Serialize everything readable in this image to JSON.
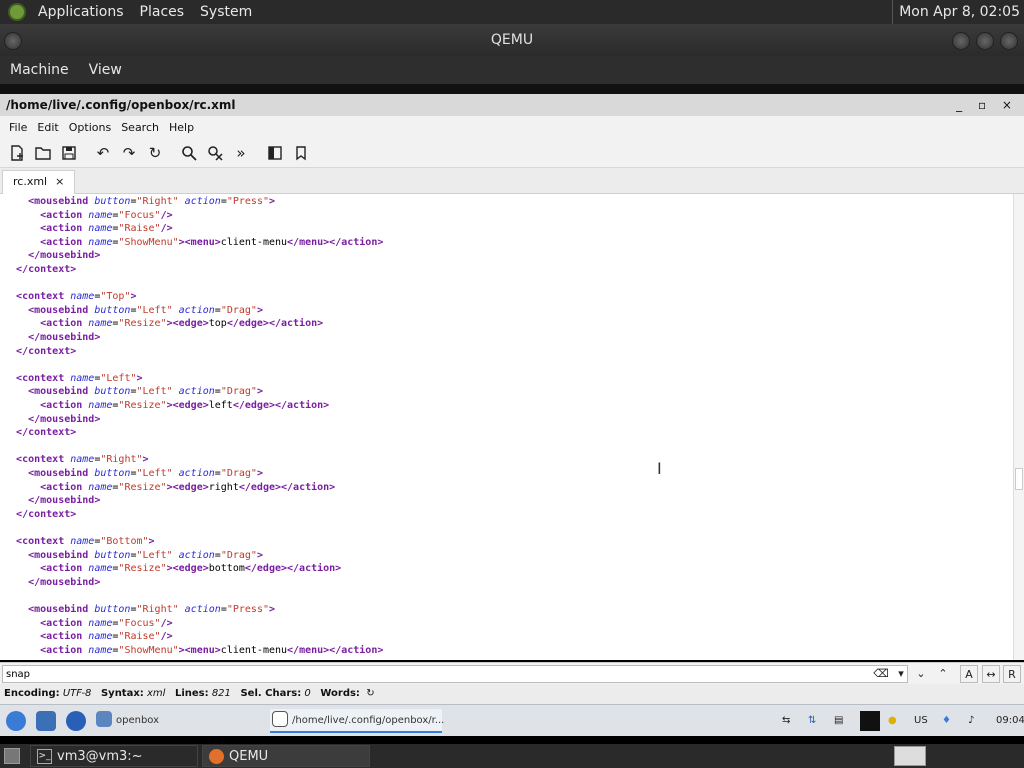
{
  "host_panel": {
    "menus": [
      "Applications",
      "Places",
      "System"
    ],
    "clock": "Mon Apr  8, 02:05"
  },
  "qemu": {
    "title": "QEMU",
    "menus": [
      "Machine",
      "View"
    ]
  },
  "editor": {
    "title": "/home/live/.config/openbox/rc.xml",
    "window_controls": "_ ▫ ×",
    "menus": {
      "file": "File",
      "edit": "Edit",
      "options": "Options",
      "search": "Search",
      "help": "Help"
    },
    "tab": {
      "label": "rc.xml",
      "close": "×"
    },
    "search": {
      "value": "snap"
    },
    "status": {
      "encoding_label": "Encoding:",
      "encoding": "UTF-8",
      "syntax_label": "Syntax:",
      "syntax": "xml",
      "lines_label": "Lines:",
      "lines": "821",
      "sel_label": "Sel. Chars:",
      "sel": "0",
      "words_label": "Words:"
    }
  },
  "guest_taskbar": {
    "folder_task": "openbox",
    "editor_task": "/home/live/.config/openbox/r...",
    "keyboard": "US",
    "clock": "09:04"
  },
  "host_bottom": {
    "terminal_task": "vm3@vm3:~",
    "qemu_task": "QEMU"
  },
  "code_lines": [
    [
      [
        "    ",
        ""
      ],
      [
        "<mousebind",
        "tag"
      ],
      [
        " button",
        "attr"
      ],
      [
        "=",
        ""
      ],
      [
        "\"Right\"",
        "val"
      ],
      [
        " action",
        "attr"
      ],
      [
        "=",
        ""
      ],
      [
        "\"Press\"",
        "val"
      ],
      [
        ">",
        "tag"
      ]
    ],
    [
      [
        "      ",
        ""
      ],
      [
        "<action",
        "tag"
      ],
      [
        " name",
        "attr"
      ],
      [
        "=",
        ""
      ],
      [
        "\"Focus\"",
        "val"
      ],
      [
        "/>",
        "tag"
      ]
    ],
    [
      [
        "      ",
        ""
      ],
      [
        "<action",
        "tag"
      ],
      [
        " name",
        "attr"
      ],
      [
        "=",
        ""
      ],
      [
        "\"Raise\"",
        "val"
      ],
      [
        "/>",
        "tag"
      ]
    ],
    [
      [
        "      ",
        ""
      ],
      [
        "<action",
        "tag"
      ],
      [
        " name",
        "attr"
      ],
      [
        "=",
        ""
      ],
      [
        "\"ShowMenu\"",
        "val"
      ],
      [
        "><menu>",
        "tag"
      ],
      [
        "client-menu",
        ""
      ],
      [
        "</menu></action>",
        "tag"
      ]
    ],
    [
      [
        "    ",
        ""
      ],
      [
        "</mousebind>",
        "tag"
      ]
    ],
    [
      [
        "  ",
        ""
      ],
      [
        "</context>",
        "tag"
      ]
    ],
    [],
    [
      [
        "  ",
        ""
      ],
      [
        "<context",
        "tag"
      ],
      [
        " name",
        "attr"
      ],
      [
        "=",
        ""
      ],
      [
        "\"Top\"",
        "val"
      ],
      [
        ">",
        "tag"
      ]
    ],
    [
      [
        "    ",
        ""
      ],
      [
        "<mousebind",
        "tag"
      ],
      [
        " button",
        "attr"
      ],
      [
        "=",
        ""
      ],
      [
        "\"Left\"",
        "val"
      ],
      [
        " action",
        "attr"
      ],
      [
        "=",
        ""
      ],
      [
        "\"Drag\"",
        "val"
      ],
      [
        ">",
        "tag"
      ]
    ],
    [
      [
        "      ",
        ""
      ],
      [
        "<action",
        "tag"
      ],
      [
        " name",
        "attr"
      ],
      [
        "=",
        ""
      ],
      [
        "\"Resize\"",
        "val"
      ],
      [
        "><edge>",
        "tag"
      ],
      [
        "top",
        ""
      ],
      [
        "</edge></action>",
        "tag"
      ]
    ],
    [
      [
        "    ",
        ""
      ],
      [
        "</mousebind>",
        "tag"
      ]
    ],
    [
      [
        "  ",
        ""
      ],
      [
        "</context>",
        "tag"
      ]
    ],
    [],
    [
      [
        "  ",
        ""
      ],
      [
        "<context",
        "tag"
      ],
      [
        " name",
        "attr"
      ],
      [
        "=",
        ""
      ],
      [
        "\"Left\"",
        "val"
      ],
      [
        ">",
        "tag"
      ]
    ],
    [
      [
        "    ",
        ""
      ],
      [
        "<mousebind",
        "tag"
      ],
      [
        " button",
        "attr"
      ],
      [
        "=",
        ""
      ],
      [
        "\"Left\"",
        "val"
      ],
      [
        " action",
        "attr"
      ],
      [
        "=",
        ""
      ],
      [
        "\"Drag\"",
        "val"
      ],
      [
        ">",
        "tag"
      ]
    ],
    [
      [
        "      ",
        ""
      ],
      [
        "<action",
        "tag"
      ],
      [
        " name",
        "attr"
      ],
      [
        "=",
        ""
      ],
      [
        "\"Resize\"",
        "val"
      ],
      [
        "><edge>",
        "tag"
      ],
      [
        "left",
        ""
      ],
      [
        "</edge></action>",
        "tag"
      ]
    ],
    [
      [
        "    ",
        ""
      ],
      [
        "</mousebind>",
        "tag"
      ]
    ],
    [
      [
        "  ",
        ""
      ],
      [
        "</context>",
        "tag"
      ]
    ],
    [],
    [
      [
        "  ",
        ""
      ],
      [
        "<context",
        "tag"
      ],
      [
        " name",
        "attr"
      ],
      [
        "=",
        ""
      ],
      [
        "\"Right\"",
        "val"
      ],
      [
        ">",
        "tag"
      ]
    ],
    [
      [
        "    ",
        ""
      ],
      [
        "<mousebind",
        "tag"
      ],
      [
        " button",
        "attr"
      ],
      [
        "=",
        ""
      ],
      [
        "\"Left\"",
        "val"
      ],
      [
        " action",
        "attr"
      ],
      [
        "=",
        ""
      ],
      [
        "\"Drag\"",
        "val"
      ],
      [
        ">",
        "tag"
      ]
    ],
    [
      [
        "      ",
        ""
      ],
      [
        "<action",
        "tag"
      ],
      [
        " name",
        "attr"
      ],
      [
        "=",
        ""
      ],
      [
        "\"Resize\"",
        "val"
      ],
      [
        "><edge>",
        "tag"
      ],
      [
        "right",
        ""
      ],
      [
        "</edge></action>",
        "tag"
      ]
    ],
    [
      [
        "    ",
        ""
      ],
      [
        "</mousebind>",
        "tag"
      ]
    ],
    [
      [
        "  ",
        ""
      ],
      [
        "</context>",
        "tag"
      ]
    ],
    [],
    [
      [
        "  ",
        ""
      ],
      [
        "<context",
        "tag"
      ],
      [
        " name",
        "attr"
      ],
      [
        "=",
        ""
      ],
      [
        "\"Bottom\"",
        "val"
      ],
      [
        ">",
        "tag"
      ]
    ],
    [
      [
        "    ",
        ""
      ],
      [
        "<mousebind",
        "tag"
      ],
      [
        " button",
        "attr"
      ],
      [
        "=",
        ""
      ],
      [
        "\"Left\"",
        "val"
      ],
      [
        " action",
        "attr"
      ],
      [
        "=",
        ""
      ],
      [
        "\"Drag\"",
        "val"
      ],
      [
        ">",
        "tag"
      ]
    ],
    [
      [
        "      ",
        ""
      ],
      [
        "<action",
        "tag"
      ],
      [
        " name",
        "attr"
      ],
      [
        "=",
        ""
      ],
      [
        "\"Resize\"",
        "val"
      ],
      [
        "><edge>",
        "tag"
      ],
      [
        "bottom",
        ""
      ],
      [
        "</edge></action>",
        "tag"
      ]
    ],
    [
      [
        "    ",
        ""
      ],
      [
        "</mousebind>",
        "tag"
      ]
    ],
    [],
    [
      [
        "    ",
        ""
      ],
      [
        "<mousebind",
        "tag"
      ],
      [
        " button",
        "attr"
      ],
      [
        "=",
        ""
      ],
      [
        "\"Right\"",
        "val"
      ],
      [
        " action",
        "attr"
      ],
      [
        "=",
        ""
      ],
      [
        "\"Press\"",
        "val"
      ],
      [
        ">",
        "tag"
      ]
    ],
    [
      [
        "      ",
        ""
      ],
      [
        "<action",
        "tag"
      ],
      [
        " name",
        "attr"
      ],
      [
        "=",
        ""
      ],
      [
        "\"Focus\"",
        "val"
      ],
      [
        "/>",
        "tag"
      ]
    ],
    [
      [
        "      ",
        ""
      ],
      [
        "<action",
        "tag"
      ],
      [
        " name",
        "attr"
      ],
      [
        "=",
        ""
      ],
      [
        "\"Raise\"",
        "val"
      ],
      [
        "/>",
        "tag"
      ]
    ],
    [
      [
        "      ",
        ""
      ],
      [
        "<action",
        "tag"
      ],
      [
        " name",
        "attr"
      ],
      [
        "=",
        ""
      ],
      [
        "\"ShowMenu\"",
        "val"
      ],
      [
        "><menu>",
        "tag"
      ],
      [
        "client-menu",
        ""
      ],
      [
        "</menu></action>",
        "tag"
      ]
    ]
  ]
}
